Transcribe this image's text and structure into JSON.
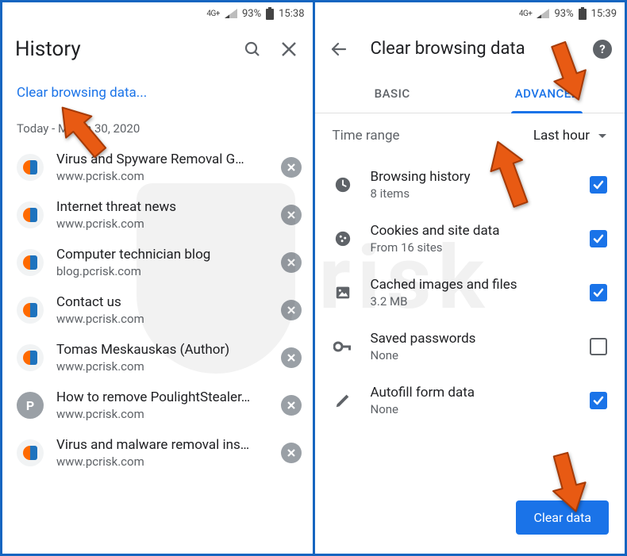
{
  "left": {
    "status": {
      "net": "4G+",
      "battery_pct": "93%",
      "time": "15:38"
    },
    "header_title": "History",
    "clear_link": "Clear browsing data...",
    "date_header": "Today - March 30, 2020",
    "items": [
      {
        "title": "Virus and Spyware Removal G…",
        "url": "www.pcrisk.com",
        "icon": "pcrisk"
      },
      {
        "title": "Internet threat news",
        "url": "www.pcrisk.com",
        "icon": "pcrisk"
      },
      {
        "title": "Computer technician blog",
        "url": "blog.pcrisk.com",
        "icon": "pcrisk"
      },
      {
        "title": "Contact us",
        "url": "www.pcrisk.com",
        "icon": "pcrisk"
      },
      {
        "title": "Tomas Meskauskas (Author)",
        "url": "www.pcrisk.com",
        "icon": "pcrisk"
      },
      {
        "title": "How to remove PoulightStealer…",
        "url": "www.pcrisk.com",
        "icon": "letter-p"
      },
      {
        "title": "Virus and malware removal ins…",
        "url": "www.pcrisk.com",
        "icon": "pcrisk"
      }
    ]
  },
  "right": {
    "status": {
      "net": "4G+",
      "battery_pct": "93%",
      "time": "15:39"
    },
    "header_title": "Clear browsing data",
    "tabs": {
      "basic": "BASIC",
      "advanced": "ADVANCED",
      "active": "advanced"
    },
    "time_range": {
      "label": "Time range",
      "value": "Last hour"
    },
    "items": [
      {
        "icon": "clock",
        "title": "Browsing history",
        "sub": "8 items",
        "checked": true
      },
      {
        "icon": "cookie",
        "title": "Cookies and site data",
        "sub": "From 16 sites",
        "checked": true
      },
      {
        "icon": "image",
        "title": "Cached images and files",
        "sub": "3.2 MB",
        "checked": true
      },
      {
        "icon": "key",
        "title": "Saved passwords",
        "sub": "None",
        "checked": false
      },
      {
        "icon": "pencil",
        "title": "Autofill form data",
        "sub": "None",
        "checked": true
      }
    ],
    "clear_button": "Clear data"
  },
  "watermark": "PCrisk.com"
}
